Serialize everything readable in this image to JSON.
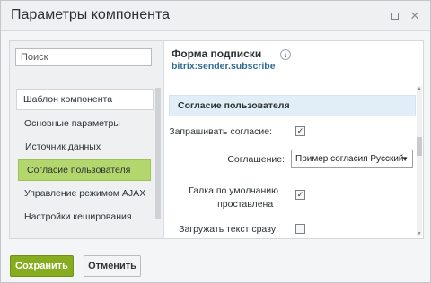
{
  "dialog": {
    "title": "Параметры компонента",
    "restore_icon": "restore-icon",
    "close_icon": "close-icon"
  },
  "sidebar": {
    "search_placeholder": "Поиск",
    "items": [
      {
        "label": "Шаблон компонента",
        "style": "boxed"
      },
      {
        "label": "Основные параметры",
        "style": "plain"
      },
      {
        "label": "Источник данных",
        "style": "sub"
      },
      {
        "label": "Согласие пользователя",
        "style": "active"
      },
      {
        "label": "Управление режимом AJAX",
        "style": "plain"
      },
      {
        "label": "Настройки кеширования",
        "style": "plain"
      }
    ]
  },
  "panel": {
    "form_title": "Форма подписки",
    "form_code": "bitrix:sender.subscribe",
    "section_title": "Согласие пользователя",
    "request_consent_label": "Запрашивать согласие:",
    "request_consent_checked": true,
    "agreement_label": "Соглашение:",
    "agreement_selected": "Пример согласия Русский",
    "default_checked_label_line1": "Галка по умолчанию",
    "default_checked_label_line2": "проставлена :",
    "default_checked_checked": true,
    "load_text_label": "Загружать текст сразу:",
    "load_text_checked": false
  },
  "footer": {
    "save_label": "Сохранить",
    "cancel_label": "Отменить"
  },
  "colors": {
    "accent_green": "#86ad1f",
    "active_item": "#b3d66d",
    "section_head": "#e1eef7",
    "link_blue": "#2f6a94"
  }
}
